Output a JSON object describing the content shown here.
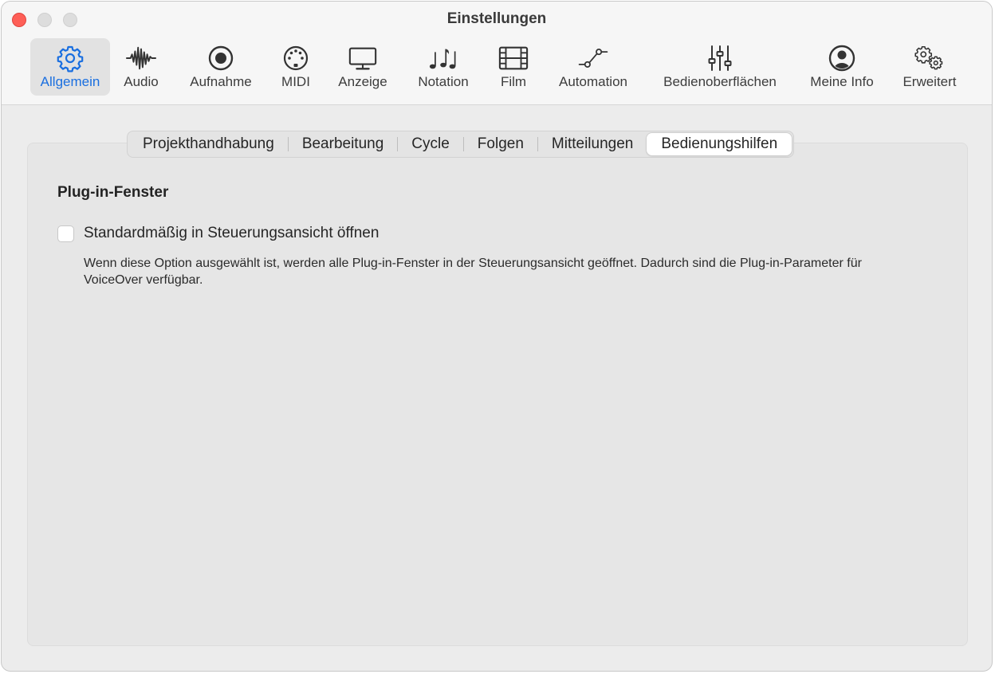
{
  "window": {
    "title": "Einstellungen"
  },
  "toolbar": {
    "items": [
      {
        "label": "Allgemein",
        "icon": "gear-icon",
        "selected": true
      },
      {
        "label": "Audio",
        "icon": "waveform-icon"
      },
      {
        "label": "Aufnahme",
        "icon": "record-icon"
      },
      {
        "label": "MIDI",
        "icon": "midi-port-icon"
      },
      {
        "label": "Anzeige",
        "icon": "display-icon"
      },
      {
        "label": "Notation",
        "icon": "music-notes-icon"
      },
      {
        "label": "Film",
        "icon": "film-icon"
      },
      {
        "label": "Automation",
        "icon": "automation-curve-icon"
      },
      {
        "label": "Bedienoberflächen",
        "icon": "sliders-icon"
      },
      {
        "label": "Meine Info",
        "icon": "person-icon"
      },
      {
        "label": "Erweitert",
        "icon": "gears-icon"
      }
    ]
  },
  "tabs": {
    "items": [
      {
        "label": "Projekthandhabung"
      },
      {
        "label": "Bearbeitung"
      },
      {
        "label": "Cycle"
      },
      {
        "label": "Folgen"
      },
      {
        "label": "Mitteilungen"
      },
      {
        "label": "Bedienungshilfen",
        "active": true
      }
    ]
  },
  "content": {
    "section_title": "Plug-in-Fenster",
    "checkbox": {
      "label": "Standardmäßig in Steuerungsansicht öffnen",
      "checked": false
    },
    "description": "Wenn diese Option ausgewählt ist, werden alle Plug-in-Fenster in der Steuerungsansicht geöffnet. Dadurch sind die Plug-in-Parameter für VoiceOver verfügbar."
  },
  "colors": {
    "accent": "#1a6fe0",
    "close": "#fe5f57",
    "icon": "#333333"
  }
}
